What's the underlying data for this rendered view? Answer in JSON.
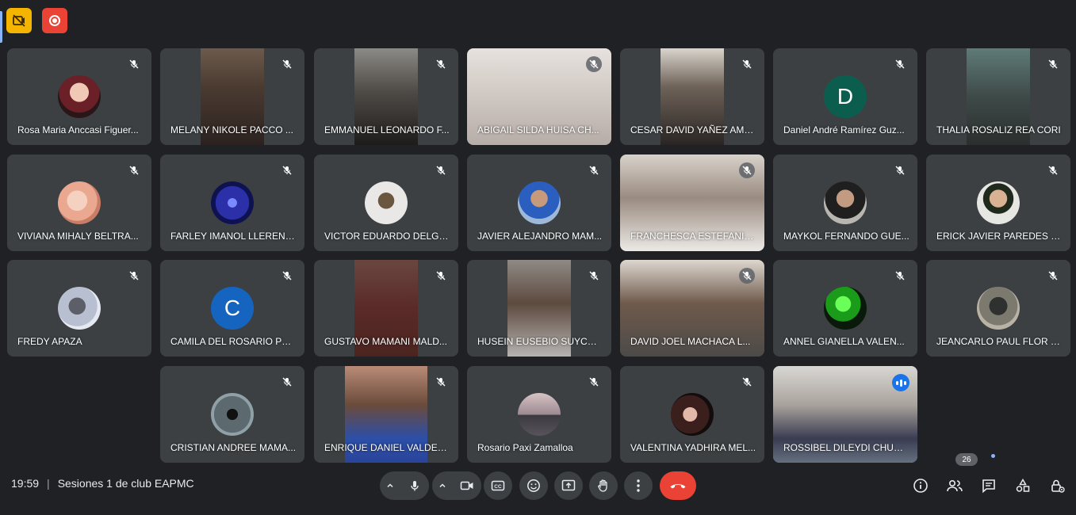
{
  "meeting": {
    "time": "19:59",
    "title": "Sesiones 1 de club EAPMC",
    "participant_count": "26"
  },
  "colors": {
    "background": "#202124",
    "tile": "#3c4043",
    "leave": "#ea4335",
    "accent": "#8ab4f8",
    "letter_avatar_d": "#0b5e4e",
    "letter_avatar_c": "#1565c0"
  },
  "participants": [
    {
      "name": "Rosa Maria Anccasi Figuer..."
    },
    {
      "name": "MELANY NIKOLE PACCO ..."
    },
    {
      "name": "EMMANUEL LEONARDO F..."
    },
    {
      "name": "ABIGAIL SILDA HUISA CH..."
    },
    {
      "name": "CESAR DAVID YAÑEZ AMA..."
    },
    {
      "name": "Daniel André Ramírez Guz...",
      "initial": "D"
    },
    {
      "name": "THALIA ROSALIZ REA CORI"
    },
    {
      "name": "VIVIANA MIHALY BELTRA..."
    },
    {
      "name": "FARLEY IMANOL LLERENA..."
    },
    {
      "name": "VICTOR EDUARDO DELGA..."
    },
    {
      "name": "JAVIER ALEJANDRO MAM..."
    },
    {
      "name": "FRANCHESCA ESTEFANIA..."
    },
    {
      "name": "MAYKOL FERNANDO GUE..."
    },
    {
      "name": "ERICK JAVIER PAREDES H..."
    },
    {
      "name": "FREDY APAZA"
    },
    {
      "name": "CAMILA DEL ROSARIO PO...",
      "initial": "C"
    },
    {
      "name": "GUSTAVO MAMANI MALD..."
    },
    {
      "name": "HUSEIN EUSEBIO SUYCO ..."
    },
    {
      "name": "DAVID JOEL MACHACA L..."
    },
    {
      "name": "ANNEL GIANELLA VALEN..."
    },
    {
      "name": "JEANCARLO PAUL FLOR T..."
    },
    {
      "name": "CRISTIAN ANDREE MAMA..."
    },
    {
      "name": "ENRIQUE DANIEL VALDER..."
    },
    {
      "name": "Rosario Paxi Zamalloa"
    },
    {
      "name": "VALENTINA YADHIRA MEL..."
    },
    {
      "name": "ROSSIBEL DILEYDI CHURA..."
    }
  ],
  "icons": {
    "mic_muted": "mic-off-icon",
    "speaking": "audio-bars-icon",
    "top_left": [
      "recording-sessions-icon",
      "record-icon"
    ],
    "controls": [
      "chevron-up-icon",
      "mic-icon",
      "chevron-up-icon",
      "camera-icon",
      "captions-icon",
      "emoji-icon",
      "present-icon",
      "raise-hand-icon",
      "more-options-icon",
      "call-end-icon"
    ],
    "right": [
      "info-icon",
      "people-icon",
      "chat-icon",
      "activities-icon",
      "host-controls-icon"
    ]
  }
}
